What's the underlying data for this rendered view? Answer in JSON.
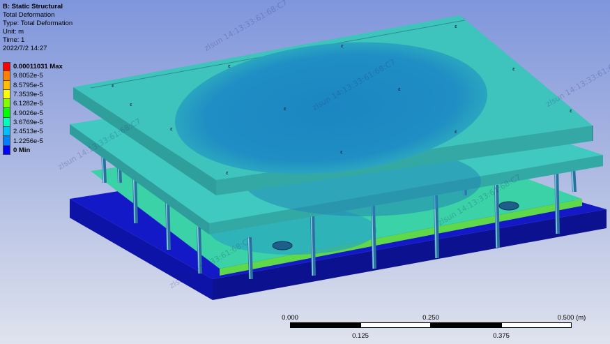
{
  "info": {
    "title": "B: Static Structural",
    "result": "Total Deformation",
    "type": "Type: Total Deformation",
    "unit": "Unit: m",
    "time": "Time: 1",
    "date": "2022/7/2 14:27"
  },
  "legend": [
    {
      "label": "0.00011031 Max",
      "color": "#ff0000",
      "bold": true
    },
    {
      "label": "9.8052e-5",
      "color": "#ff7f00",
      "bold": false
    },
    {
      "label": "8.5795e-5",
      "color": "#ffbf00",
      "bold": false
    },
    {
      "label": "7.3539e-5",
      "color": "#ffff00",
      "bold": false
    },
    {
      "label": "6.1282e-5",
      "color": "#7fff00",
      "bold": false
    },
    {
      "label": "4.9026e-5",
      "color": "#00ff00",
      "bold": false
    },
    {
      "label": "3.6769e-5",
      "color": "#00ffbf",
      "bold": false
    },
    {
      "label": "2.4513e-5",
      "color": "#00bfff",
      "bold": false
    },
    {
      "label": "1.2256e-5",
      "color": "#007fff",
      "bold": false
    },
    {
      "label": "0 Min",
      "color": "#0000ff",
      "bold": true
    }
  ],
  "scalebar": {
    "top_labels": [
      "0.000",
      "0.250",
      "0.500 (m)"
    ],
    "bottom_labels": [
      "0.125",
      "0.375"
    ]
  },
  "watermark": "zlsun 14:13:33:61:68:C7",
  "colors": {
    "plate_top": "#3cc7c2",
    "plate_side": "#33a9a6",
    "hot_zone": "#1f8ec4",
    "base": "#1419c8",
    "base_side": "#0a0f96",
    "pillar": "#2a6f9e"
  }
}
